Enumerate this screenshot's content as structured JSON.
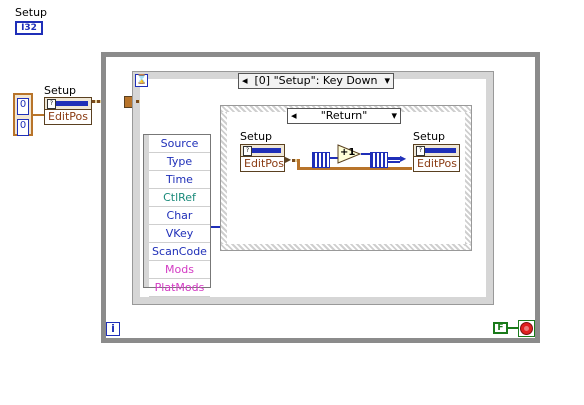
{
  "top_indicator": {
    "label": "Setup",
    "type": "I32"
  },
  "cluster_constant": {
    "values": [
      "0",
      "0"
    ]
  },
  "bundle_outer": {
    "label": "Setup",
    "field": "EditPos"
  },
  "event_structure": {
    "selector": "[0] \"Setup\": Key Down",
    "event_data_items": [
      "Source",
      "Type",
      "Time",
      "CtlRef",
      "Char",
      "VKey",
      "ScanCode",
      "Mods",
      "PlatMods"
    ],
    "colors": {
      "Source": "#1f2fb8",
      "Type": "#1f2fb8",
      "Time": "#1f2fb8",
      "CtlRef": "#1a8a7a",
      "Char": "#1f2fb8",
      "VKey": "#1f2fb8",
      "ScanCode": "#1f2fb8",
      "Mods": "#d43bc4",
      "PlatMods": "#d43bc4"
    }
  },
  "case_structure": {
    "selector": "\"Return\""
  },
  "inner_unbundle": {
    "label": "Setup",
    "field": "EditPos"
  },
  "inner_bundle": {
    "label": "Setup",
    "field": "EditPos"
  },
  "increment": {
    "text": "+1"
  },
  "loop_iteration": {
    "text": "i"
  },
  "stop_constant": {
    "text": "F"
  }
}
